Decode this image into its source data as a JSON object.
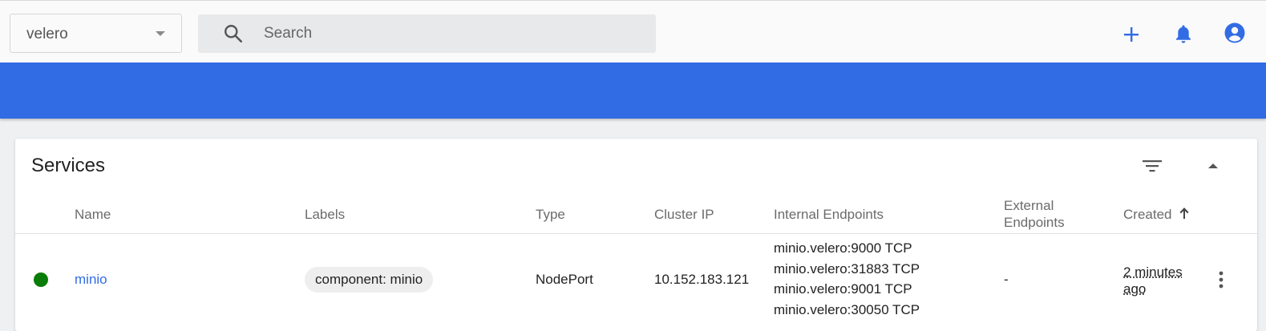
{
  "toolbar": {
    "namespace": "velero",
    "search_placeholder": "Search",
    "icons": [
      "add-icon",
      "bell-icon",
      "account-icon"
    ],
    "accent_color": "#326ce5"
  },
  "card": {
    "title": "Services",
    "columns": {
      "name": "Name",
      "labels": "Labels",
      "type": "Type",
      "cluster_ip": "Cluster IP",
      "internal_endpoints": "Internal Endpoints",
      "external_endpoints_line1": "External",
      "external_endpoints_line2": "Endpoints",
      "created": "Created"
    },
    "rows": [
      {
        "status_color": "#097d07",
        "name": "minio",
        "label": "component: minio",
        "type": "NodePort",
        "cluster_ip": "10.152.183.121",
        "internal_endpoints": [
          "minio.velero:9000 TCP",
          "minio.velero:31883 TCP",
          "minio.velero:9001 TCP",
          "minio.velero:30050 TCP"
        ],
        "external_endpoints": "-",
        "created_line1": "2 minutes",
        "created_line2": "ago"
      }
    ]
  }
}
